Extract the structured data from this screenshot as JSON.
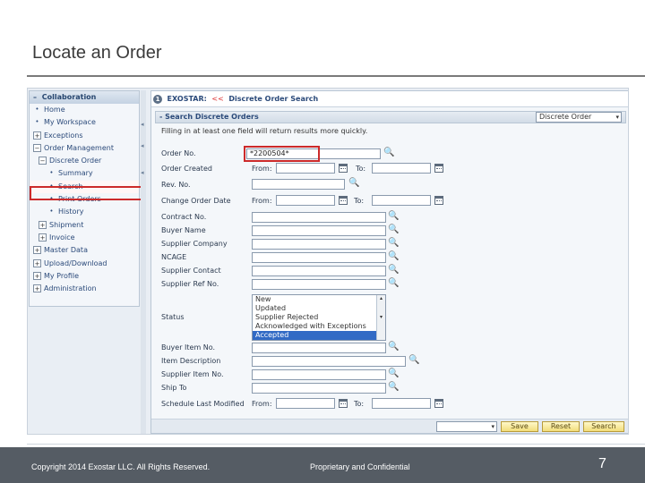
{
  "slide": {
    "title": "Locate an Order",
    "footer_copyright": "Copyright 2014 Exostar LLC. All Rights Reserved.",
    "footer_proprietary": "Proprietary and Confidential",
    "page_number": "7"
  },
  "nav": {
    "header_toggle": "–",
    "header": "Collaboration",
    "items": [
      {
        "label": "Home"
      },
      {
        "label": "My Workspace"
      },
      {
        "label": "Exceptions"
      },
      {
        "label": "Order Management"
      },
      {
        "label": "Discrete Order"
      },
      {
        "label": "Summary"
      },
      {
        "label": "Search"
      },
      {
        "label": "Print Orders"
      },
      {
        "label": "History"
      },
      {
        "label": "Shipment"
      },
      {
        "label": "Invoice"
      },
      {
        "label": "Master Data"
      },
      {
        "label": "Upload/Download"
      },
      {
        "label": "My Profile"
      },
      {
        "label": "Administration"
      }
    ]
  },
  "breadcrumb": {
    "brand": "EXOSTAR:",
    "separator": "<<",
    "page": "Discrete Order Search"
  },
  "section": {
    "title": "- Search Discrete Orders",
    "dropdown_value": "Discrete Order",
    "hint": "Filling in at least one field will return results more quickly."
  },
  "form": {
    "order_no_label": "Order No.",
    "order_no_value": "*2200504*",
    "order_created_label": "Order Created",
    "rev_no_label": "Rev. No.",
    "change_order_date_label": "Change Order Date",
    "contract_no_label": "Contract No.",
    "buyer_name_label": "Buyer Name",
    "supplier_company_label": "Supplier Company",
    "ncage_label": "NCAGE",
    "supplier_contact_label": "Supplier Contact",
    "supplier_ref_label": "Supplier Ref No.",
    "status_label": "Status",
    "status_options": [
      "New",
      "Updated",
      "Supplier Rejected",
      "Acknowledged with Exceptions",
      "Accepted"
    ],
    "buyer_item_label": "Buyer Item No.",
    "item_description_label": "Item Description",
    "supplier_item_label": "Supplier Item No.",
    "ship_to_label": "Ship To",
    "schedule_modified_label": "Schedule Last Modified",
    "from_label": "From:",
    "to_label": "To:",
    "to_label_plain": "To:"
  },
  "buttons": {
    "save": "Save",
    "reset": "Reset",
    "search": "Search"
  }
}
